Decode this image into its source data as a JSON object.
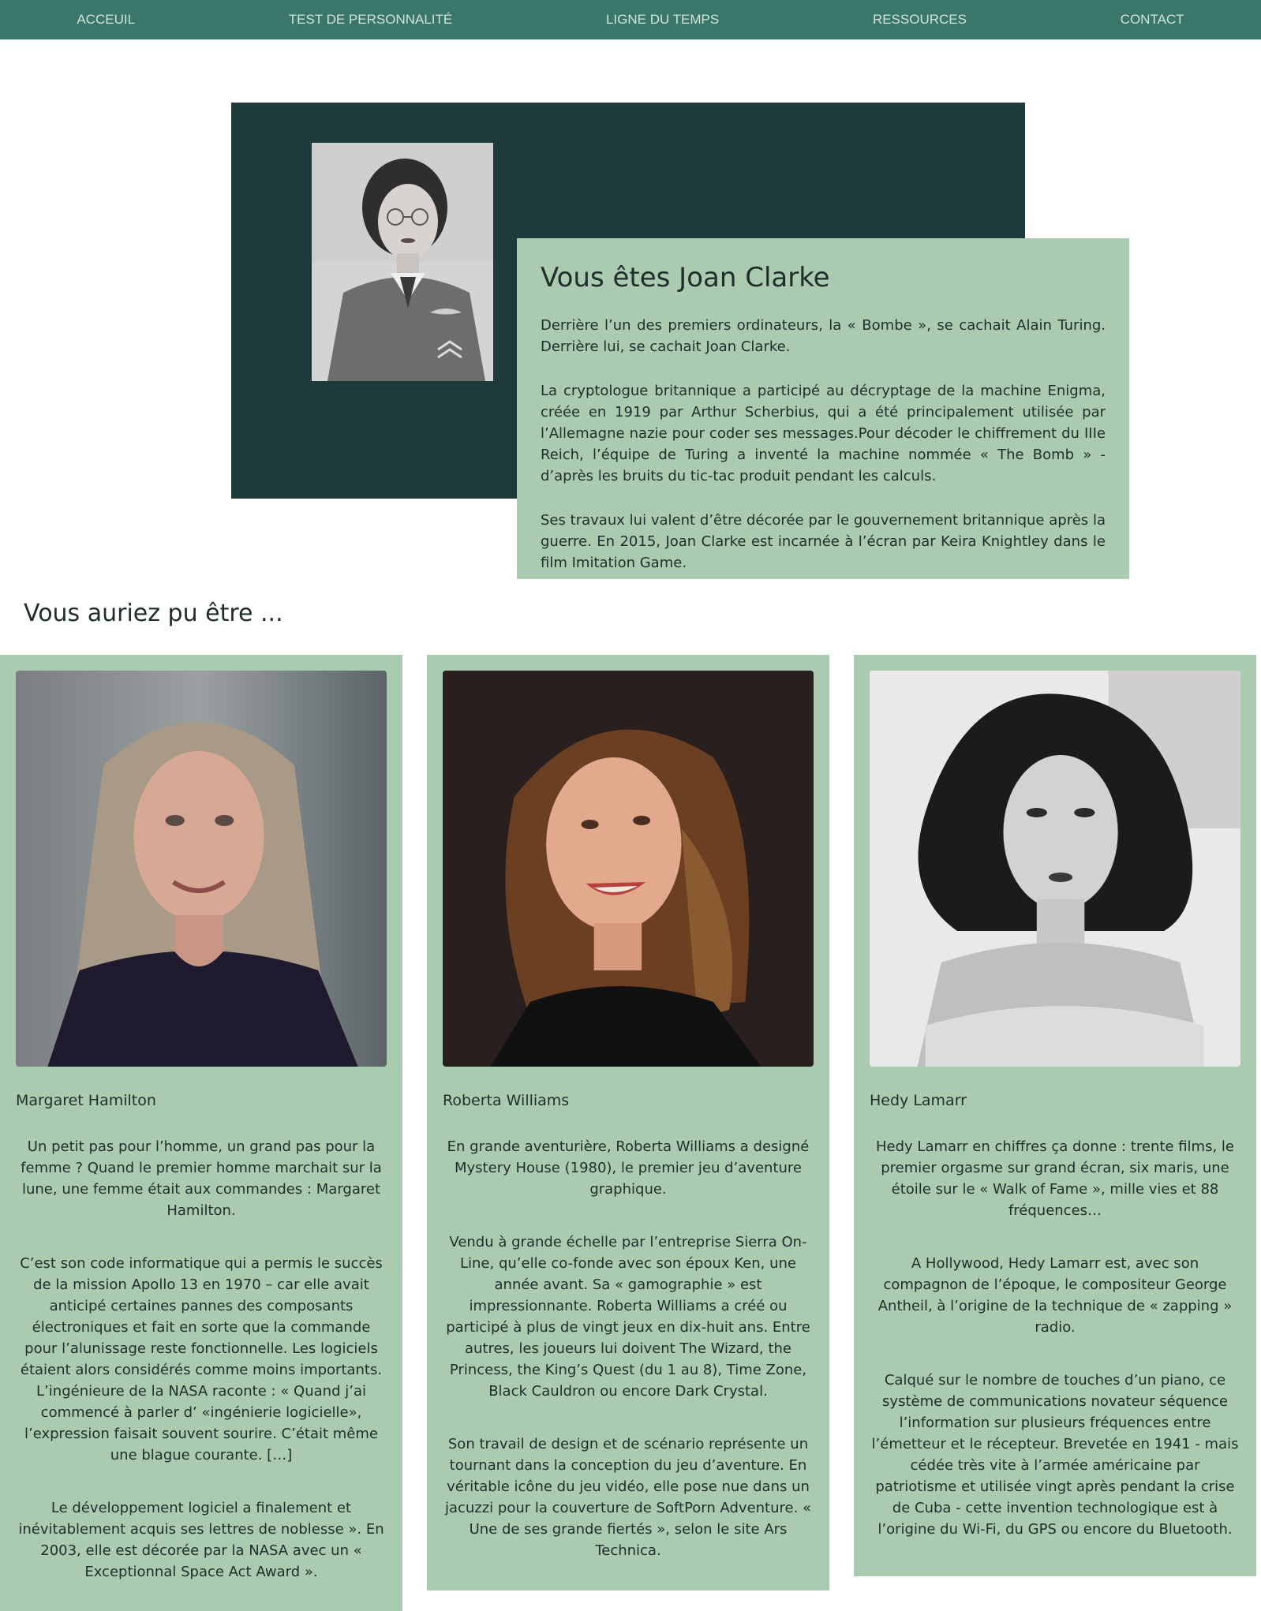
{
  "nav": {
    "items": [
      "Acceuil",
      "Test de personnalité",
      "Ligne du temps",
      "Ressources",
      "Contact"
    ]
  },
  "hero": {
    "title": "Vous êtes Joan Clarke",
    "paragraphs": [
      "Derrière l’un des premiers ordinateurs, la « Bombe », se cachait Alain Turing. Derrière lui, se cachait Joan Clarke.",
      "La cryptologue britannique a participé au décryptage de la machine Enigma, créée en 1919 par Arthur Scherbius, qui a été principalement utilisée par l’Allemagne nazie pour coder ses messages.Pour décoder le chiffrement du IIIe Reich, l’équipe de Turing a inventé la machine nommée « The Bomb » - d’après les bruits du tic-tac produit pendant les calculs.",
      "Ses travaux lui valent d’être décorée par le gouvernement britannique après la guerre. En 2015, Joan Clarke est incarnée à l’écran par Keira Knightley dans le film Imitation Game."
    ]
  },
  "section_title": "Vous auriez pu être ...",
  "cards": [
    {
      "name": "Margaret Hamilton",
      "paragraphs": [
        "Un petit pas pour l’homme, un grand pas pour la femme ? Quand le premier homme marchait sur la lune, une femme était aux commandes : Margaret Hamilton.",
        "C’est son code informatique qui a permis le succès de la mission Apollo 13 en 1970 – car elle avait anticipé certaines pannes des composants électroniques et fait en sorte que la commande pour l’alunissage reste fonctionnelle. Les logiciels étaient alors considérés comme moins importants. L’ingénieure de la NASA raconte : « Quand j’ai commencé à parler d’ «ingénierie logicielle», l’expression faisait souvent sourire. C’était même une blague courante. […]",
        "Le développement logiciel a finalement et inévitablement acquis ses lettres de noblesse ». En 2003, elle est décorée par la NASA avec un « Exceptionnal Space Act Award »."
      ]
    },
    {
      "name": "Roberta Williams",
      "paragraphs": [
        "En grande aventurière, Roberta Williams a designé Mystery House (1980), le premier jeu d’aventure graphique.",
        "Vendu à grande échelle par l’entreprise Sierra On-Line, qu’elle co-fonde avec son époux Ken, une année avant. Sa « gamographie » est impressionnante. Roberta Williams a créé ou participé à plus de vingt jeux en dix-huit ans. Entre autres, les joueurs lui doivent The Wizard, the Princess, the King’s Quest (du 1 au 8), Time Zone, Black Cauldron ou encore Dark Crystal.",
        "Son travail de design et de scénario représente un tournant dans la conception du jeu d’aventure. En véritable icône du jeu vidéo, elle pose nue dans un jacuzzi pour la couverture de SoftPorn Adventure. « Une de ses grande fiertés », selon le site Ars Technica."
      ]
    },
    {
      "name": "Hedy Lamarr",
      "paragraphs": [
        "Hedy Lamarr en chiffres ça donne : trente films, le premier orgasme sur grand écran, six maris, une étoile sur le « Walk of Fame », mille vies et 88 fréquences…",
        "A Hollywood, Hedy Lamarr est, avec son compagnon de l’époque, le compositeur George Antheil, à l’origine de la technique de « zapping » radio.",
        "Calqué sur le nombre de touches d’un piano, ce système de communications novateur séquence l’information sur plusieurs fréquences entre l’émetteur et le récepteur. Brevetée en 1941 - mais cédée très vite à l’armée américaine par patriotisme et utilisée vingt après pendant la crise de Cuba - cette invention technologique est à l’origine du Wi-Fi, du GPS ou encore du Bluetooth."
      ]
    }
  ],
  "colors": {
    "nav_bg": "#3a7669",
    "nav_text": "#cfe5d6",
    "hero_bg": "#1f3a3b",
    "card_bg": "#abcbb0",
    "text": "#1f2d2b"
  }
}
